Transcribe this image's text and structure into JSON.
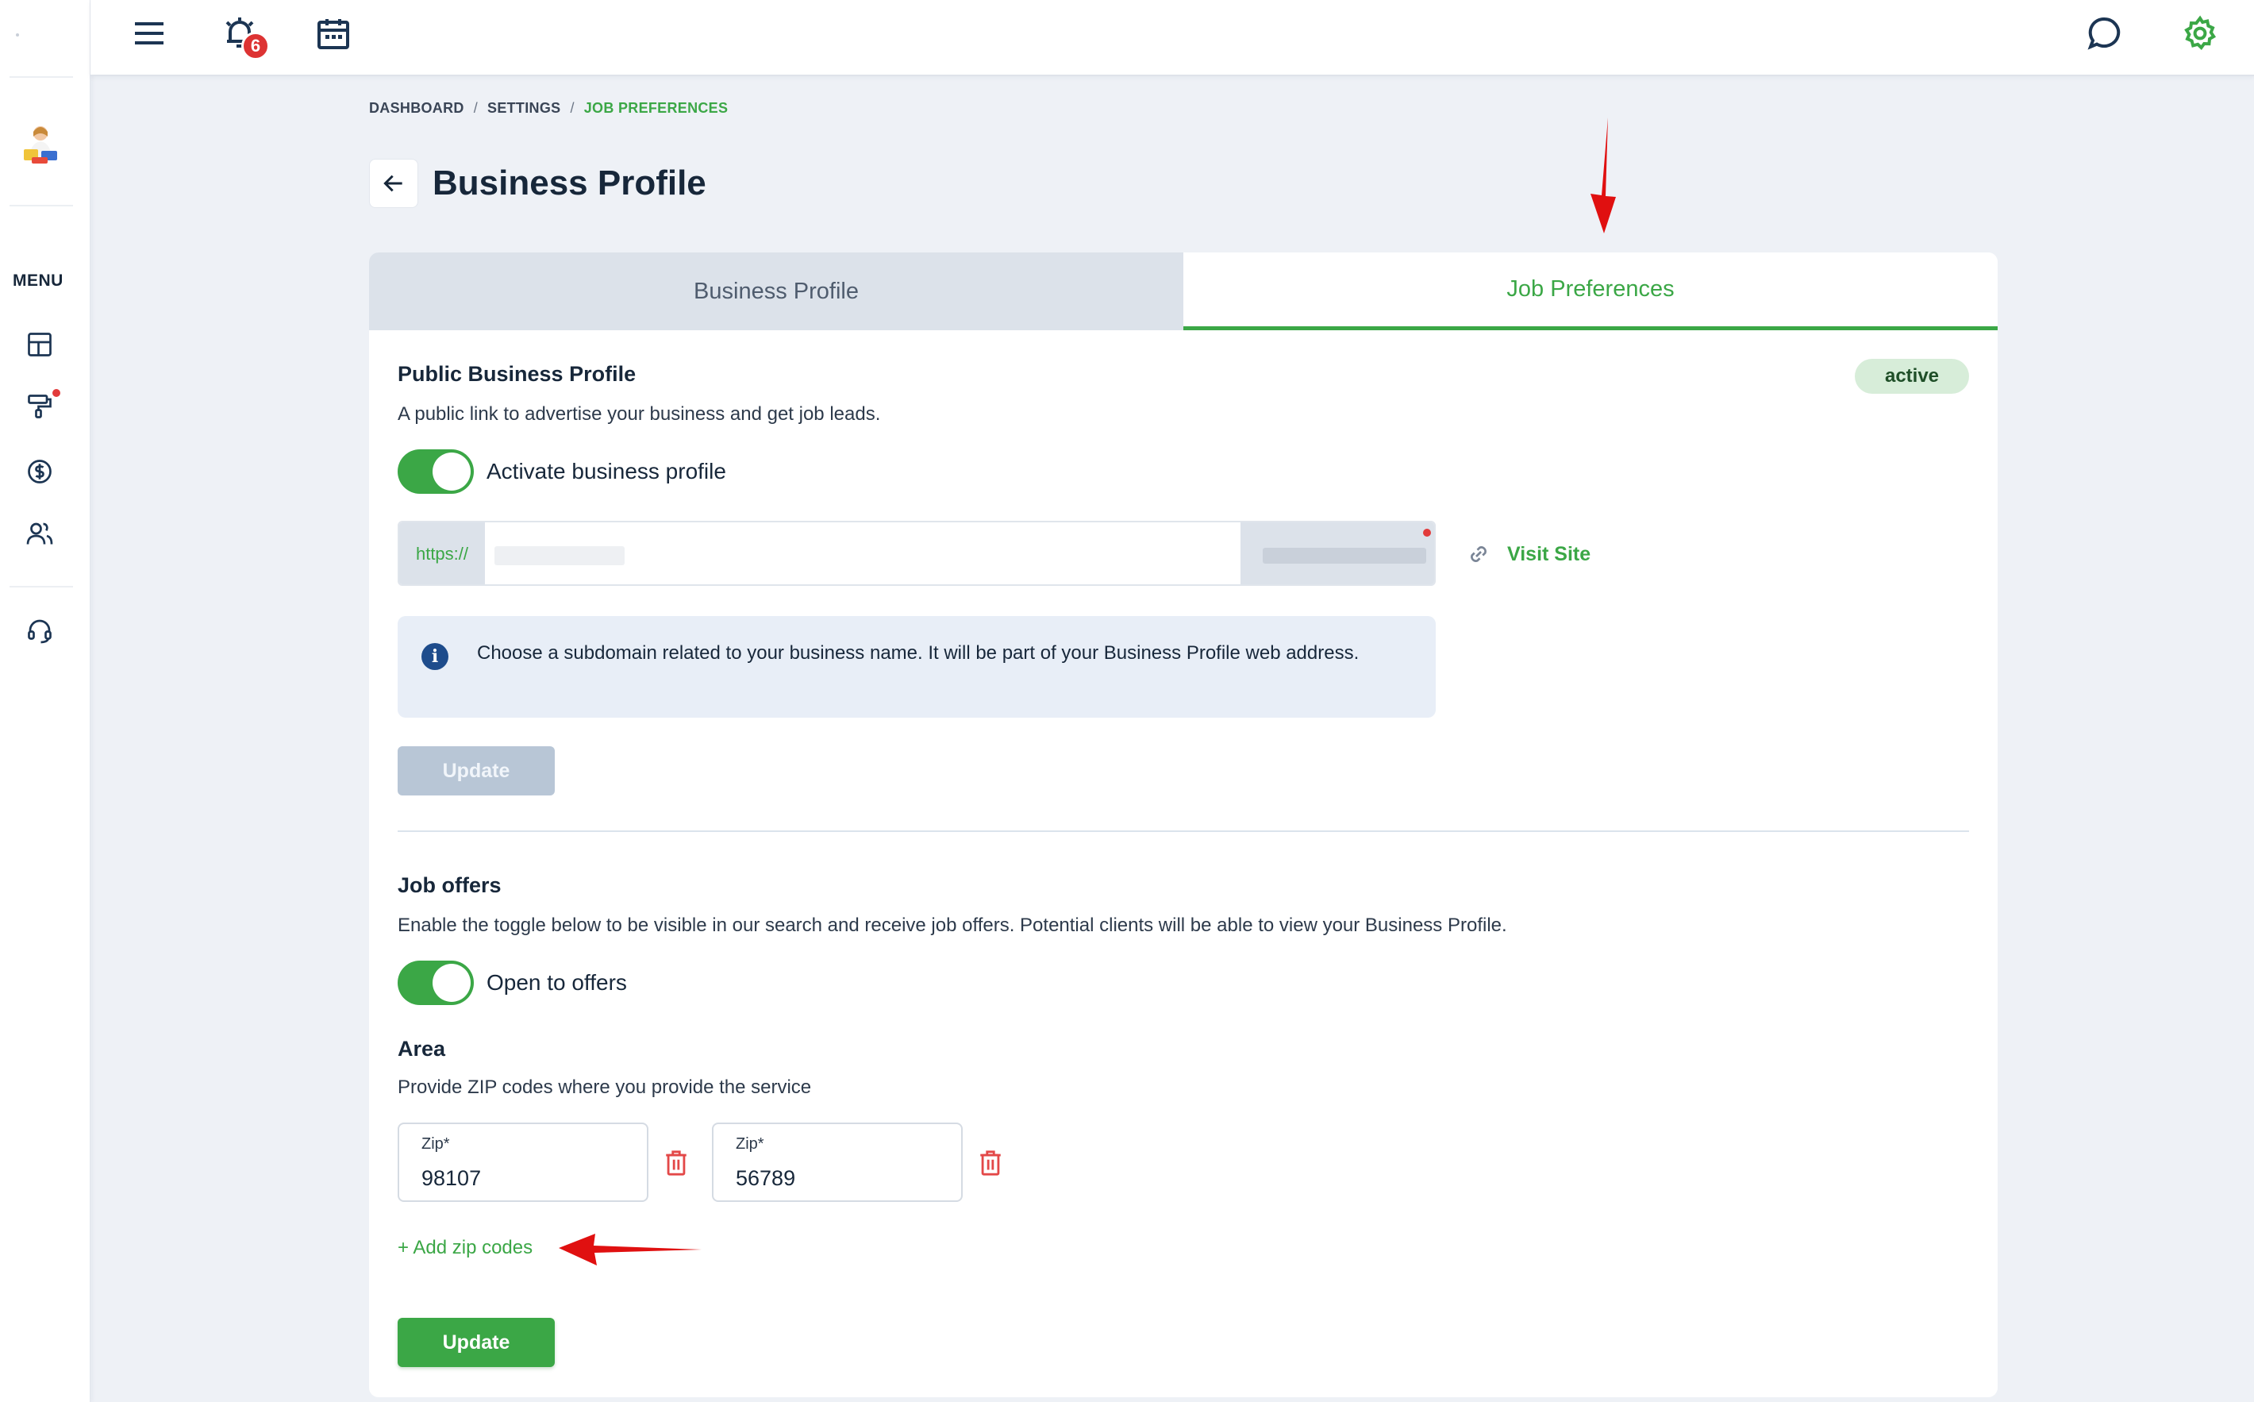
{
  "sidebar": {
    "menu_label": "MENU",
    "items": [
      {
        "icon": "dashboard-grid-icon"
      },
      {
        "icon": "paint-roller-icon",
        "has_notification": true
      },
      {
        "icon": "dollar-circle-icon"
      },
      {
        "icon": "users-icon"
      },
      {
        "icon": "headset-support-icon"
      }
    ]
  },
  "topbar": {
    "notifications_count": "6",
    "icons": [
      "hamburger-menu-icon",
      "alarm-clock-icon",
      "calendar-icon",
      "chat-bubble-icon",
      "gear-icon"
    ]
  },
  "breadcrumb": {
    "items": [
      "DASHBOARD",
      "SETTINGS"
    ],
    "current": "JOB PREFERENCES",
    "separator": "/"
  },
  "page": {
    "title": "Business Profile"
  },
  "tabs": [
    {
      "label": "Business Profile",
      "active": false
    },
    {
      "label": "Job Preferences",
      "active": true
    }
  ],
  "public_profile": {
    "title": "Public Business Profile",
    "description": "A public link to advertise your business and get job leads.",
    "status": "active",
    "toggle_label": "Activate business profile",
    "toggle_on": true,
    "url_prefix": "https://",
    "visit_site_label": "Visit Site",
    "info_text": "Choose a subdomain related to your business name. It will be part of your Business Profile web address.",
    "update_label": "Update"
  },
  "job_offers": {
    "title": "Job offers",
    "description": "Enable the toggle below to be visible in our search and receive job offers. Potential clients will be able to view your Business Profile.",
    "toggle_label": "Open to offers",
    "toggle_on": true
  },
  "area": {
    "title": "Area",
    "description": "Provide ZIP codes where you provide the service",
    "zip_label": "Zip*",
    "zips": [
      "98107",
      "56789"
    ],
    "add_label": "+ Add zip codes",
    "update_label": "Update"
  },
  "colors": {
    "accent": "#3ba746",
    "badge": "#dd3333",
    "annotation": "#e01010",
    "tab_inactive_bg": "#dce2ea",
    "info_bg": "#e8eef7"
  }
}
